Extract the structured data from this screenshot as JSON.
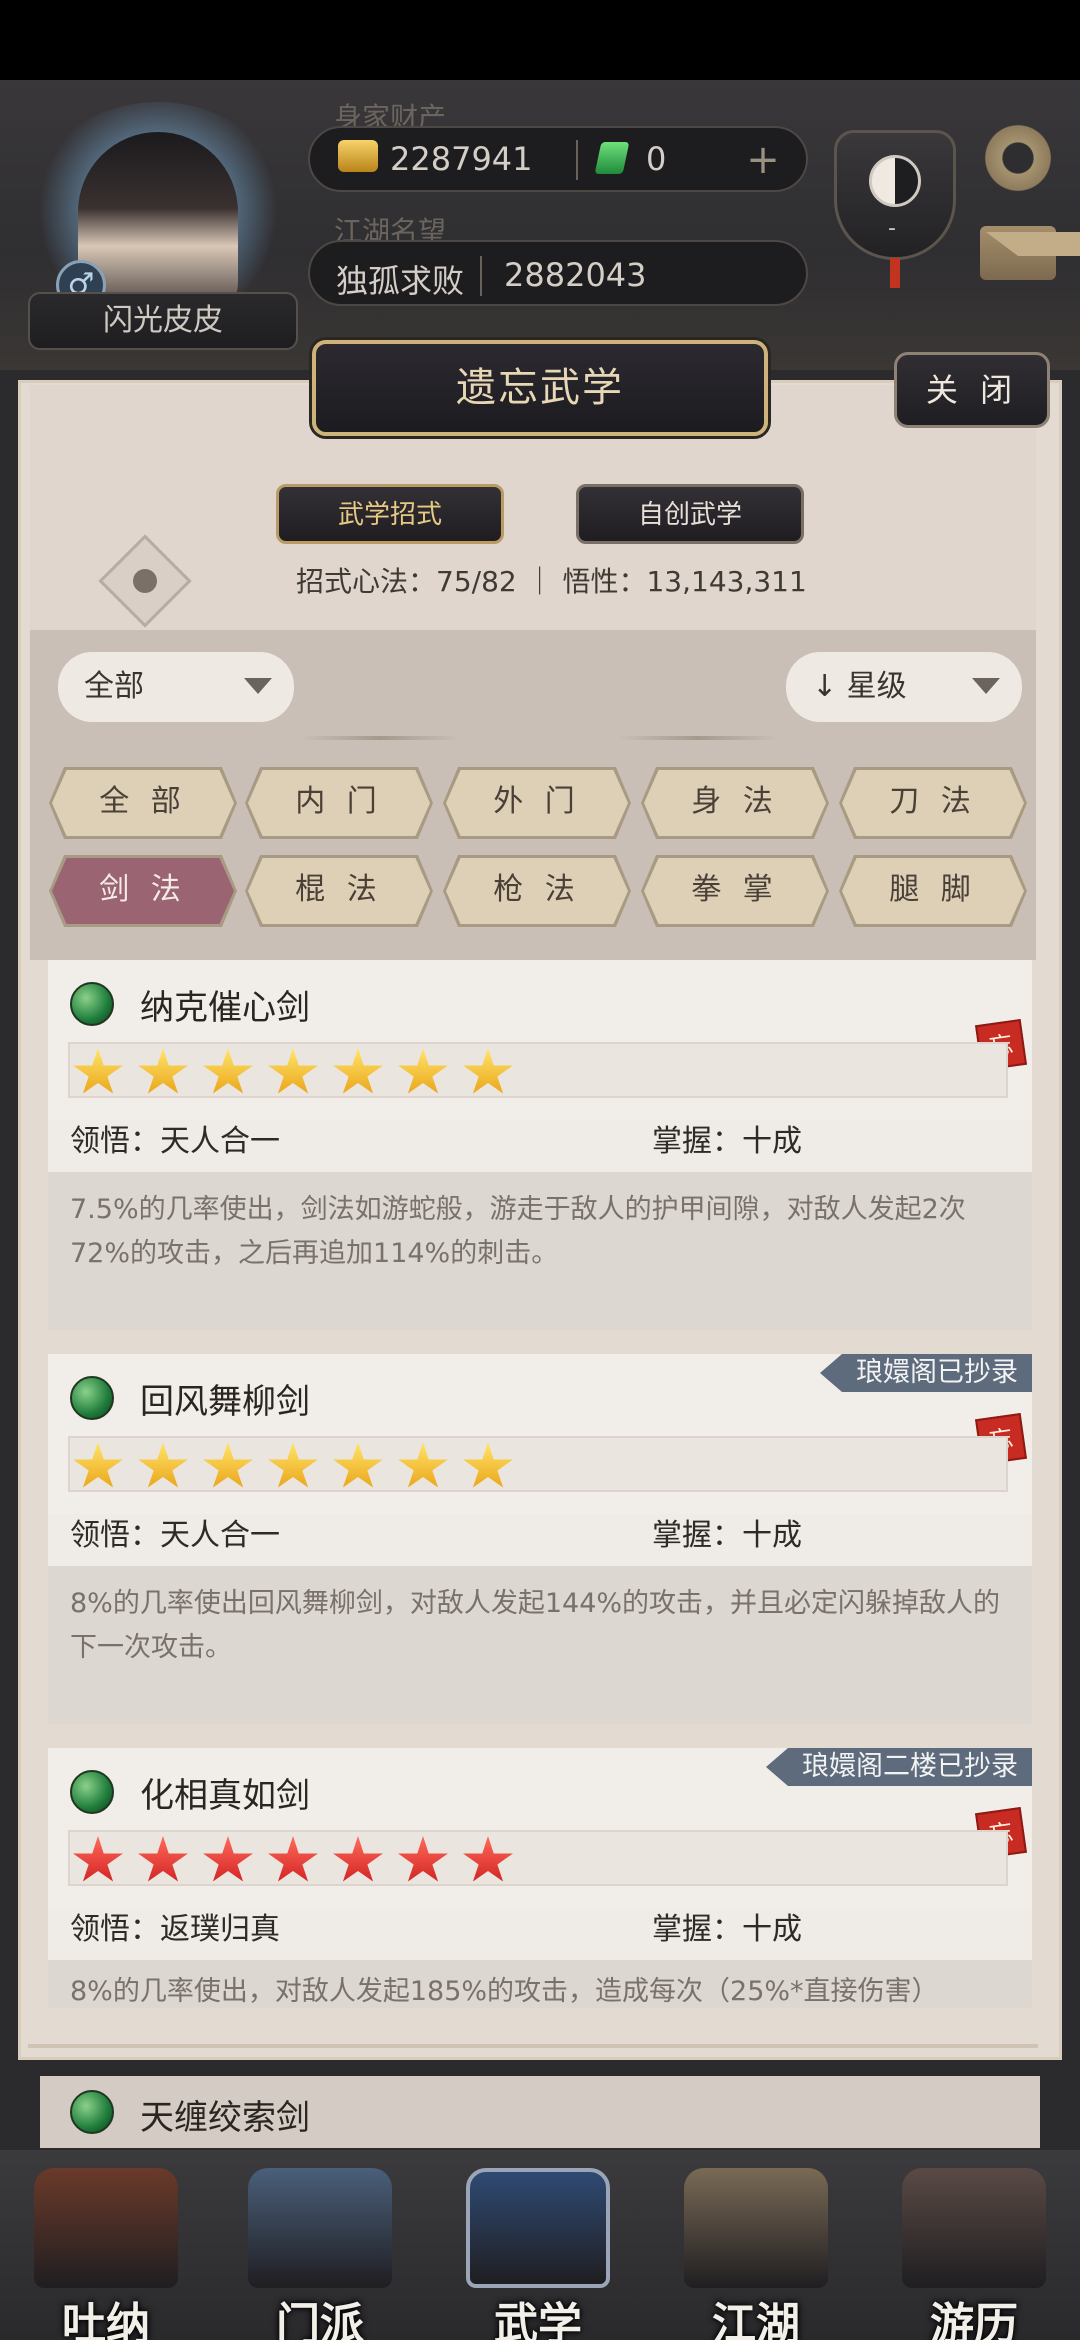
{
  "header": {
    "player_name": "闪光皮皮",
    "gender_symbol": "♂",
    "wealth_label": "身家财产",
    "gold_amount": "2287941",
    "jade_amount": "0",
    "reputation_label": "江湖名望",
    "reputation_title": "独孤求败",
    "reputation_value": "2882043",
    "emblem_dash": "-"
  },
  "panel": {
    "title": "遗忘武学",
    "close_label": "关 闭",
    "tabs": [
      {
        "label": "武学招式",
        "active": true
      },
      {
        "label": "自创武学",
        "active": false
      }
    ],
    "stats_line": "招式心法：75/82 ｜ 悟性：13,143,311"
  },
  "filters": {
    "category_select": "全部",
    "sort_select": "↓ 星级",
    "chips": [
      {
        "label": "全 部",
        "active": false
      },
      {
        "label": "内 门",
        "active": false
      },
      {
        "label": "外 门",
        "active": false
      },
      {
        "label": "身 法",
        "active": false
      },
      {
        "label": "刀 法",
        "active": false
      },
      {
        "label": "剑 法",
        "active": true
      },
      {
        "label": "棍 法",
        "active": false
      },
      {
        "label": "枪 法",
        "active": false
      },
      {
        "label": "拳 掌",
        "active": false
      },
      {
        "label": "腿 脚",
        "active": false
      }
    ]
  },
  "skills": [
    {
      "name": "纳克催心剑",
      "stars": 7,
      "star_color": "gold",
      "comprehension": "领悟：天人合一",
      "mastery": "掌握：十成",
      "description": "7.5%的几率使出，剑法如游蛇般，游走于敌人的护甲间隙，对敌人发起2次72%的攻击，之后再追加114%的刺击。",
      "forget_tag": "忘",
      "banner": ""
    },
    {
      "name": "回风舞柳剑",
      "stars": 7,
      "star_color": "gold",
      "comprehension": "领悟：天人合一",
      "mastery": "掌握：十成",
      "description": "8%的几率使出回风舞柳剑，对敌人发起144%的攻击，并且必定闪躲掉敌人的下一次攻击。",
      "forget_tag": "忘",
      "banner": "琅嬛阁已抄录"
    },
    {
      "name": "化相真如剑",
      "stars": 7,
      "star_color": "red",
      "comprehension": "领悟：返璞归真",
      "mastery": "掌握：十成",
      "description": "8%的几率使出，对敌人发起185%的攻击，造成每次（25%*直接伤害）",
      "forget_tag": "忘",
      "banner": "琅嬛阁二楼已抄录"
    }
  ],
  "under_list": {
    "peek_item": "天缠绞索剑"
  },
  "bottom_nav": [
    {
      "label": "吐纳",
      "color": "#6b3a2a"
    },
    {
      "label": "门派",
      "color": "#4a5f7a"
    },
    {
      "label": "武学",
      "color": "#2f4a73"
    },
    {
      "label": "江湖",
      "color": "#7a6a55"
    },
    {
      "label": "游历",
      "color": "#5a4a45"
    }
  ]
}
